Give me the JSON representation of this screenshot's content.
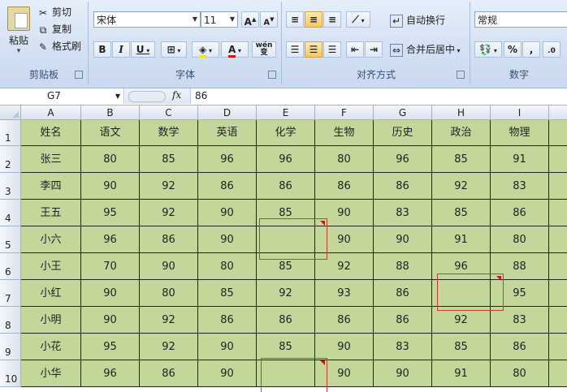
{
  "ribbon": {
    "clipboard": {
      "paste_label": "粘贴",
      "cut_label": "剪切",
      "copy_label": "复制",
      "format_painter_label": "格式刷",
      "group_label": "剪贴板"
    },
    "font": {
      "font_name": "宋体",
      "font_size": "11",
      "grow_label": "A",
      "shrink_label": "A",
      "bold_label": "B",
      "italic_label": "I",
      "underline_label": "U",
      "font_color_label": "A",
      "phonetic_label": "wén\n变",
      "group_label": "字体"
    },
    "alignment": {
      "wrap_text_label": "自动换行",
      "merge_center_label": "合并后居中",
      "group_label": "对齐方式"
    },
    "number": {
      "format_value": "常规",
      "percent_label": "%",
      "comma_label": ",",
      "group_label": "数字"
    }
  },
  "formula_bar": {
    "name_box": "G7",
    "fx_label": "fx",
    "formula": "86"
  },
  "sheet": {
    "columns": [
      "A",
      "B",
      "C",
      "D",
      "E",
      "F",
      "G",
      "H",
      "I"
    ],
    "rows": [
      "1",
      "2",
      "3",
      "4",
      "5",
      "6",
      "7",
      "8",
      "9",
      "10"
    ],
    "cells": [
      [
        "姓名",
        "语文",
        "数学",
        "英语",
        "化学",
        "生物",
        "历史",
        "政治",
        "物理"
      ],
      [
        "张三",
        "80",
        "85",
        "96",
        "96",
        "80",
        "96",
        "85",
        "91"
      ],
      [
        "李四",
        "90",
        "92",
        "86",
        "86",
        "86",
        "86",
        "92",
        "83"
      ],
      [
        "王五",
        "95",
        "92",
        "90",
        "85",
        "90",
        "83",
        "85",
        "86"
      ],
      [
        "小六",
        "96",
        "86",
        "90",
        "",
        "90",
        "90",
        "91",
        "80"
      ],
      [
        "小王",
        "70",
        "90",
        "80",
        "85",
        "92",
        "88",
        "96",
        "88"
      ],
      [
        "小红",
        "90",
        "80",
        "85",
        "92",
        "93",
        "86",
        "",
        "95"
      ],
      [
        "小明",
        "90",
        "92",
        "86",
        "86",
        "86",
        "86",
        "92",
        "83"
      ],
      [
        "小花",
        "95",
        "92",
        "90",
        "85",
        "90",
        "83",
        "85",
        "86"
      ],
      [
        "小华",
        "96",
        "86",
        "90",
        "",
        "90",
        "90",
        "91",
        "80"
      ]
    ],
    "cell_fill_color": "#c4d79b",
    "comment_box_color": "#d23c2a"
  }
}
